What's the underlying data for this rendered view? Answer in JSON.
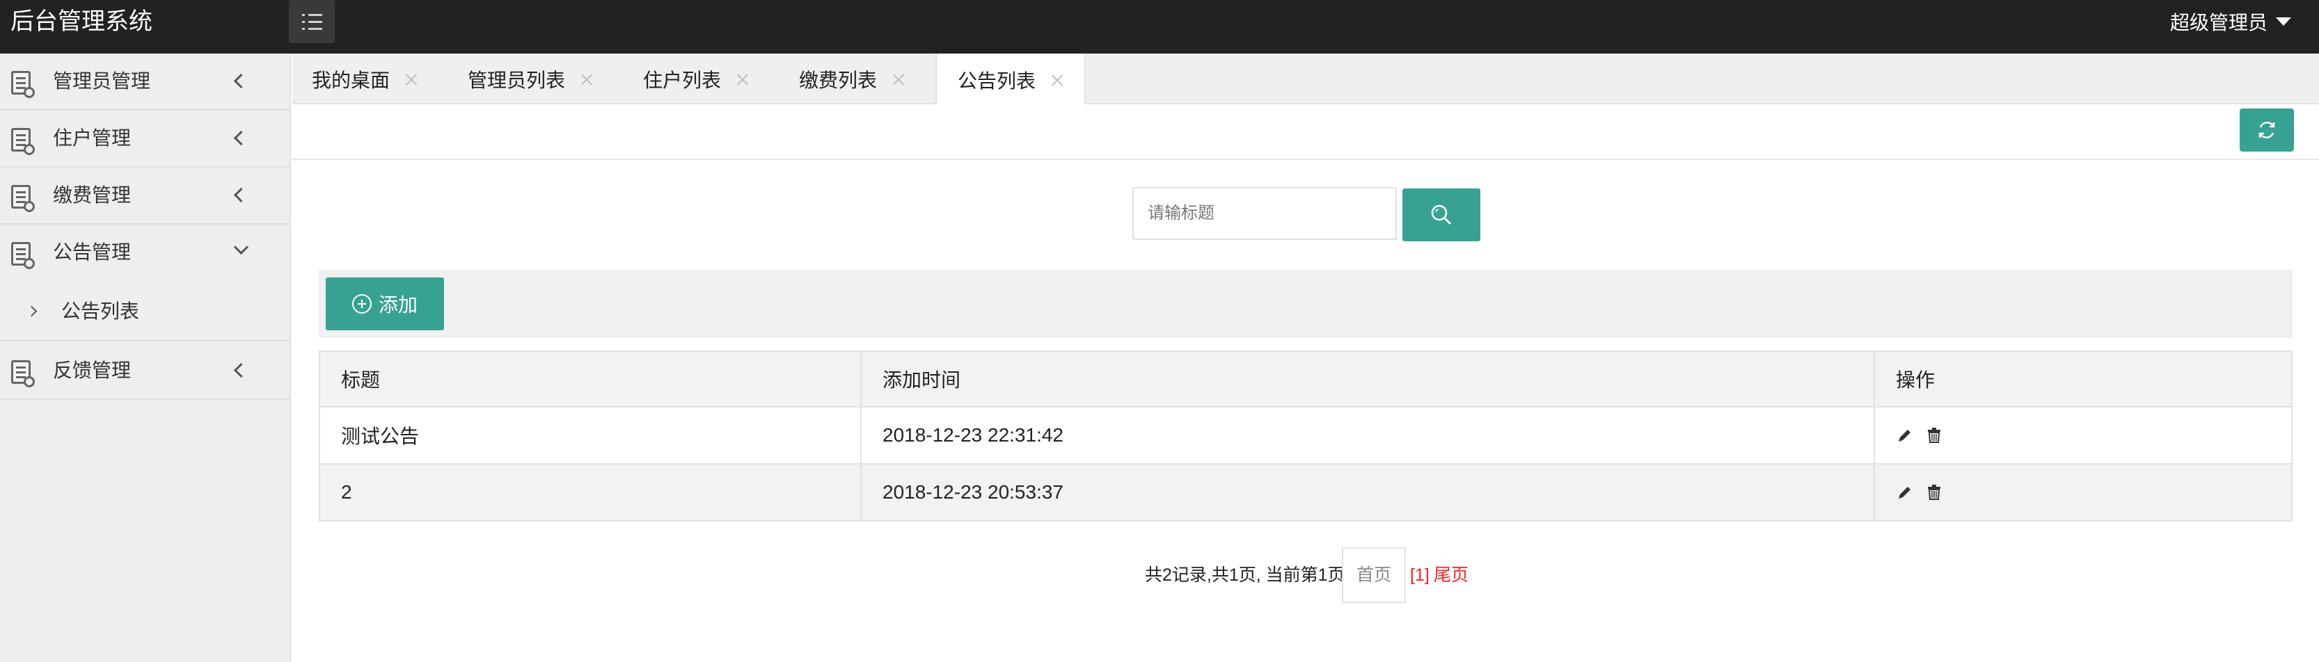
{
  "app": {
    "title": "后台管理系统"
  },
  "header": {
    "user_name": "超级管理员",
    "menu_toggle_icon": "list-icon",
    "user_caret_icon": "caret-down-icon"
  },
  "sidebar": {
    "items": [
      {
        "label": "管理员管理",
        "icon": "document-icon",
        "expanded": false
      },
      {
        "label": "住户管理",
        "icon": "document-icon",
        "expanded": false
      },
      {
        "label": "缴费管理",
        "icon": "document-icon",
        "expanded": false
      },
      {
        "label": "公告管理",
        "icon": "document-icon",
        "expanded": true,
        "children": [
          {
            "label": "公告列表"
          }
        ]
      },
      {
        "label": "反馈管理",
        "icon": "document-icon",
        "expanded": false
      }
    ]
  },
  "tabs": [
    {
      "label": "我的桌面",
      "active": false
    },
    {
      "label": "管理员列表",
      "active": false
    },
    {
      "label": "住户列表",
      "active": false
    },
    {
      "label": "缴费列表",
      "active": false
    },
    {
      "label": "公告列表",
      "active": true
    }
  ],
  "search": {
    "placeholder": "请输标题",
    "value": "",
    "button_icon": "search-icon"
  },
  "toolbar": {
    "add_label": "添加",
    "add_icon": "plus-circle-icon",
    "refresh_icon": "refresh-icon"
  },
  "table": {
    "columns": [
      "标题",
      "添加时间",
      "操作"
    ],
    "rows": [
      {
        "title": "测试公告",
        "time": "2018-12-23 22:31:42"
      },
      {
        "title": "2",
        "time": "2018-12-23 20:53:37"
      }
    ],
    "row_action_icons": [
      "edit-icon",
      "trash-icon"
    ]
  },
  "pagination": {
    "summary": "共2记录,共1页, 当前第1页",
    "first_label": "首页",
    "current_label": "[1]",
    "last_label": "尾页"
  },
  "colors": {
    "accent": "#37a292",
    "topbar": "#222222",
    "sidebar_bg": "#eeeeee",
    "link_red": "#ff2020"
  }
}
